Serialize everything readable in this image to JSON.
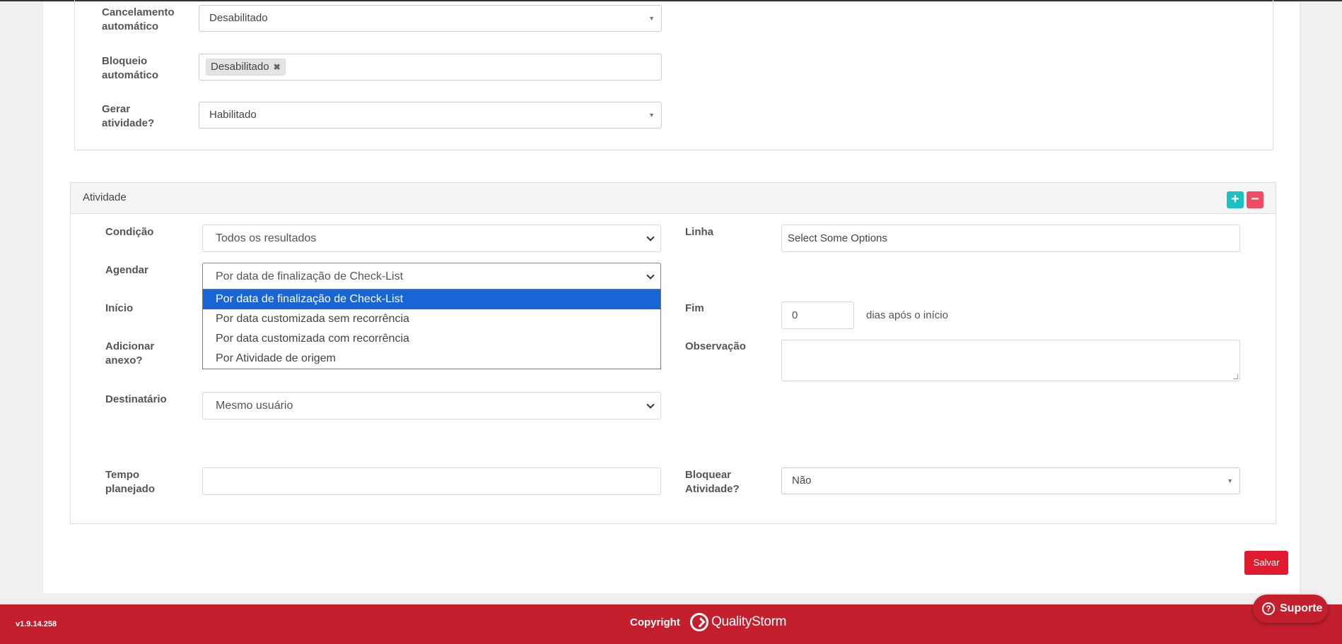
{
  "top_form": {
    "cancelamento": {
      "label_line1": "Cancelamento",
      "label_line2": "automático",
      "value": "Desabilitado"
    },
    "bloqueio": {
      "label_line1": "Bloqueio",
      "label_line2": "automático",
      "tag": "Desabilitado"
    },
    "gerar": {
      "label_line1": "Gerar",
      "label_line2": "atividade?",
      "value": "Habilitado"
    }
  },
  "atividade": {
    "title": "Atividade",
    "add_symbol": "+",
    "remove_symbol": "−",
    "condicao": {
      "label": "Condição",
      "value": "Todos os resultados"
    },
    "linha": {
      "label": "Linha",
      "placeholder": "Select Some Options"
    },
    "agendar": {
      "label": "Agendar",
      "value": "Por data de finalização de Check-List",
      "options": [
        "Por data de finalização de Check-List",
        "Por data customizada sem recorrência",
        "Por data customizada com recorrência",
        "Por Atividade de origem"
      ],
      "selected_index": 0
    },
    "inicio": {
      "label": "Início"
    },
    "fim": {
      "label": "Fim",
      "value": "0",
      "suffix": "dias após o início"
    },
    "anexo": {
      "label_line1": "Adicionar",
      "label_line2": "anexo?"
    },
    "observacao": {
      "label": "Observação",
      "value": ""
    },
    "destinatario": {
      "label": "Destinatário",
      "value": "Mesmo usuário"
    },
    "tempo": {
      "label_line1": "Tempo",
      "label_line2": "planejado",
      "value": ""
    },
    "bloquear": {
      "label_line1": "Bloquear",
      "label_line2": "Atividade?",
      "value": "Não"
    }
  },
  "save_label": "Salvar",
  "footer": {
    "version": "v1.9.14.258",
    "copyright": "Copyright",
    "brand": "QualityStorm",
    "support": "Suporte",
    "support_icon": "?"
  },
  "colors": {
    "brand_red": "#c41f2d",
    "save_red": "#e01b2f",
    "add_teal": "#1bc0c0",
    "remove_pink": "#ef4c63",
    "option_highlight": "#1a65d6"
  },
  "icons": {
    "select_arrow": "▼",
    "tag_remove": "✖"
  }
}
